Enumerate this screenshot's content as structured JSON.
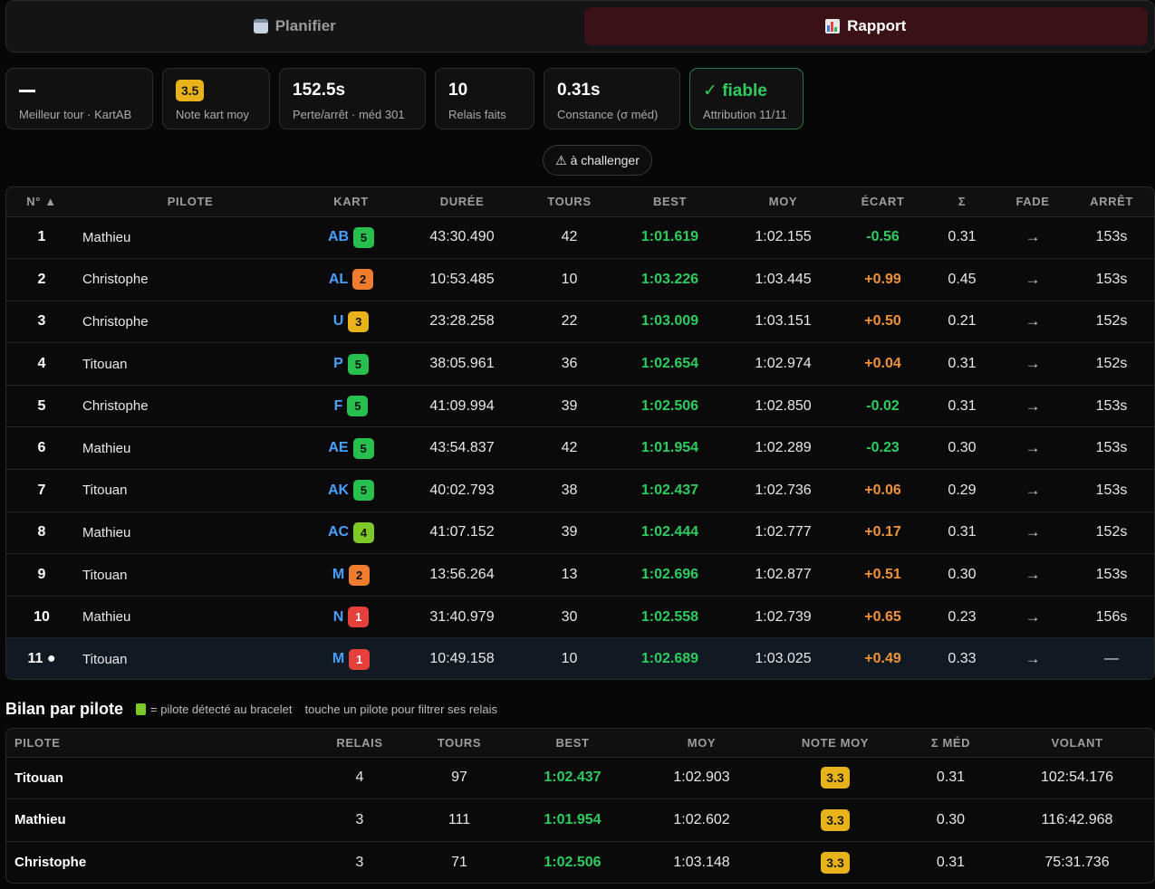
{
  "tabs": [
    {
      "label": "Planifier",
      "icon": "calendar-icon",
      "active": false
    },
    {
      "label": "Rapport",
      "icon": "bar-chart-icon",
      "active": true
    }
  ],
  "stats": [
    {
      "value": "—",
      "label": "Meilleur tour · KartAB"
    },
    {
      "value": "3.5",
      "label": "Note kart moy"
    },
    {
      "value": "152.5s",
      "label": "Perte/arrêt · méd 301"
    },
    {
      "value": "10",
      "label": "Relais faits"
    },
    {
      "value": "0.31s",
      "label": "Constance (σ méd)"
    },
    {
      "value": "✓ fiable",
      "label": "Attribution 11/11"
    }
  ],
  "challenger_label": "⚠ à challenger",
  "relais": {
    "headers": [
      "N° ▲",
      "PILOTE",
      "KART",
      "DURÉE",
      "TOURS",
      "BEST",
      "MOY",
      "ÉCART",
      "Σ",
      "FADE",
      "ARRÊT"
    ],
    "rows": [
      {
        "num": "1",
        "pilote": "Mathieu",
        "kart": "AB",
        "note": "5",
        "duree": "43:30.490",
        "tours": "42",
        "best": "1:01.619",
        "moy": "1:02.155",
        "ecart": "-0.56",
        "sigma": "0.31",
        "fade": "→",
        "arret": "153s"
      },
      {
        "num": "2",
        "pilote": "Christophe",
        "kart": "AL",
        "note": "2",
        "duree": "10:53.485",
        "tours": "10",
        "best": "1:03.226",
        "moy": "1:03.445",
        "ecart": "+0.99",
        "sigma": "0.45",
        "fade": "→",
        "arret": "153s"
      },
      {
        "num": "3",
        "pilote": "Christophe",
        "kart": "U",
        "note": "3",
        "duree": "23:28.258",
        "tours": "22",
        "best": "1:03.009",
        "moy": "1:03.151",
        "ecart": "+0.50",
        "sigma": "0.21",
        "fade": "→",
        "arret": "152s"
      },
      {
        "num": "4",
        "pilote": "Titouan",
        "kart": "P",
        "note": "5",
        "duree": "38:05.961",
        "tours": "36",
        "best": "1:02.654",
        "moy": "1:02.974",
        "ecart": "+0.04",
        "sigma": "0.31",
        "fade": "→",
        "arret": "152s"
      },
      {
        "num": "5",
        "pilote": "Christophe",
        "kart": "F",
        "note": "5",
        "duree": "41:09.994",
        "tours": "39",
        "best": "1:02.506",
        "moy": "1:02.850",
        "ecart": "-0.02",
        "sigma": "0.31",
        "fade": "→",
        "arret": "153s"
      },
      {
        "num": "6",
        "pilote": "Mathieu",
        "kart": "AE",
        "note": "5",
        "duree": "43:54.837",
        "tours": "42",
        "best": "1:01.954",
        "moy": "1:02.289",
        "ecart": "-0.23",
        "sigma": "0.30",
        "fade": "→",
        "arret": "153s"
      },
      {
        "num": "7",
        "pilote": "Titouan",
        "kart": "AK",
        "note": "5",
        "duree": "40:02.793",
        "tours": "38",
        "best": "1:02.437",
        "moy": "1:02.736",
        "ecart": "+0.06",
        "sigma": "0.29",
        "fade": "→",
        "arret": "153s"
      },
      {
        "num": "8",
        "pilote": "Mathieu",
        "kart": "AC",
        "note": "4",
        "duree": "41:07.152",
        "tours": "39",
        "best": "1:02.444",
        "moy": "1:02.777",
        "ecart": "+0.17",
        "sigma": "0.31",
        "fade": "→",
        "arret": "152s"
      },
      {
        "num": "9",
        "pilote": "Titouan",
        "kart": "M",
        "note": "2",
        "duree": "13:56.264",
        "tours": "13",
        "best": "1:02.696",
        "moy": "1:02.877",
        "ecart": "+0.51",
        "sigma": "0.30",
        "fade": "→",
        "arret": "153s"
      },
      {
        "num": "10",
        "pilote": "Mathieu",
        "kart": "N",
        "note": "1",
        "duree": "31:40.979",
        "tours": "30",
        "best": "1:02.558",
        "moy": "1:02.739",
        "ecart": "+0.65",
        "sigma": "0.23",
        "fade": "→",
        "arret": "156s"
      },
      {
        "num": "11 ●",
        "pilote": "Titouan",
        "kart": "M",
        "note": "1",
        "duree": "10:49.158",
        "tours": "10",
        "best": "1:02.689",
        "moy": "1:03.025",
        "ecart": "+0.49",
        "sigma": "0.33",
        "fade": "→",
        "arret": "—"
      }
    ]
  },
  "bilan": {
    "title": "Bilan par pilote",
    "legend": "= pilote détecté au bracelet",
    "hint": "touche un pilote pour filtrer ses relais",
    "headers": [
      "PILOTE",
      "RELAIS",
      "TOURS",
      "BEST",
      "MOY",
      "NOTE MOY",
      "Σ MÉD",
      "VOLANT"
    ],
    "rows": [
      {
        "pilote": "Titouan",
        "relais": "4",
        "tours": "97",
        "best": "1:02.437",
        "moy": "1:02.903",
        "note": "3.3",
        "sigma": "0.31",
        "volant": "102:54.176"
      },
      {
        "pilote": "Mathieu",
        "relais": "3",
        "tours": "111",
        "best": "1:01.954",
        "moy": "1:02.602",
        "note": "3.3",
        "sigma": "0.30",
        "volant": "116:42.968"
      },
      {
        "pilote": "Christophe",
        "relais": "3",
        "tours": "71",
        "best": "1:02.506",
        "moy": "1:03.148",
        "note": "3.3",
        "sigma": "0.31",
        "volant": "75:31.736"
      }
    ]
  },
  "colors": {
    "best": "#2ecc5f",
    "ecart_pos": "#f0923a",
    "kart_code": "#4aa0ff",
    "active_tab": "#3a1114"
  }
}
